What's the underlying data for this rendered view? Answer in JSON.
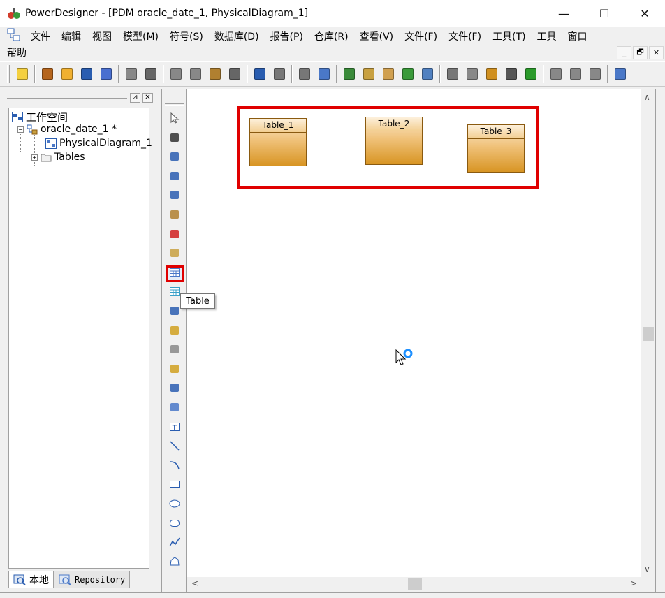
{
  "window": {
    "title": "PowerDesigner - [PDM oracle_date_1, PhysicalDiagram_1]",
    "minimize": "—",
    "maximize": "☐",
    "close": "✕"
  },
  "menu": {
    "items": [
      "文件",
      "编辑",
      "视图",
      "模型(M)",
      "符号(S)",
      "数据库(D)",
      "报告(P)",
      "仓库(R)",
      "查看(V)",
      "文件(F)",
      "文件(F)",
      "工具(T)",
      "工具",
      "窗口"
    ],
    "help": "帮助",
    "mdi": {
      "minimize": "_",
      "restore": "🗗",
      "close": "✕"
    }
  },
  "toolbar": {
    "icons": [
      "new-icon",
      "open-package-icon",
      "open-folder-icon",
      "save-icon",
      "save-all-icon",
      "print-preview-icon",
      "print-icon",
      "cut-icon",
      "copy-icon",
      "paste-icon",
      "delete-icon",
      "undo-icon",
      "redo-icon",
      "properties-icon",
      "check-model-icon",
      "new-model-icon",
      "import-icon",
      "export-icon",
      "refresh-icon",
      "generate-icon",
      "format-icon",
      "align-icon",
      "brush-icon",
      "fill-icon",
      "font-icon",
      "arrange-icon",
      "back-icon",
      "forward-icon",
      "window-icon"
    ],
    "colors": [
      "#f4d03f",
      "#b5651d",
      "#f0b030",
      "#2a5db0",
      "#4a6fd0",
      "#888888",
      "#666666",
      "#888888",
      "#888888",
      "#b08030",
      "#666666",
      "#2a5db0",
      "#777777",
      "#777777",
      "#4a78c8",
      "#3a8a3a",
      "#c8a040",
      "#d0a050",
      "#3a9a3a",
      "#5080c0",
      "#777777",
      "#888888",
      "#d09020",
      "#555555",
      "#2a9a2a",
      "#888888",
      "#888888",
      "#888888",
      "#4a78c8"
    ]
  },
  "left_panel": {
    "header": {
      "pin": "⊿",
      "close": "✕"
    },
    "tree": {
      "root": "工作空间",
      "model": "oracle_date_1 *",
      "diagram": "PhysicalDiagram_1",
      "folder": "Tables"
    },
    "tabs": {
      "local": "本地",
      "repository": "Repository"
    }
  },
  "palette": {
    "tools": [
      "pointer-icon",
      "grabber-icon",
      "zoom-in-icon",
      "zoom-out-icon",
      "zoom-fit-icon",
      "properties-icon",
      "delete-icon",
      "package-icon",
      "table-icon",
      "view-icon",
      "reference-icon",
      "procedure-icon",
      "file-icon",
      "note-icon",
      "link-icon",
      "synonym-icon",
      "text-icon",
      "line-icon",
      "arc-icon",
      "rectangle-icon",
      "ellipse-icon",
      "rounded-rect-icon",
      "polyline-icon",
      "polygon-icon"
    ],
    "selected": "table-icon",
    "tooltip": "Table"
  },
  "canvas": {
    "tables": [
      {
        "name": "Table_1"
      },
      {
        "name": "Table_2"
      },
      {
        "name": "Table_3"
      }
    ],
    "highlight_color": "#e00000"
  },
  "scrollbars": {
    "up": "∧",
    "down": "∨",
    "left": "<",
    "right": ">"
  }
}
